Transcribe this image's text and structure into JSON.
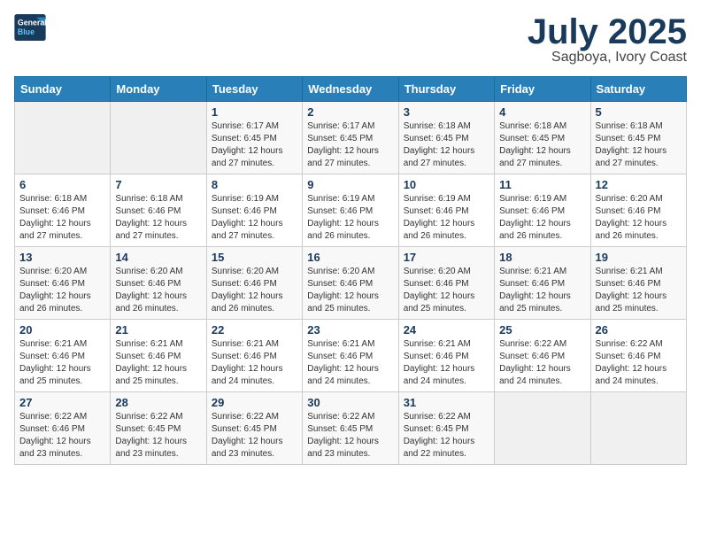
{
  "logo": {
    "line1": "General",
    "line2": "Blue"
  },
  "title": "July 2025",
  "location": "Sagboya, Ivory Coast",
  "days_of_week": [
    "Sunday",
    "Monday",
    "Tuesday",
    "Wednesday",
    "Thursday",
    "Friday",
    "Saturday"
  ],
  "weeks": [
    [
      {
        "day": "",
        "info": ""
      },
      {
        "day": "",
        "info": ""
      },
      {
        "day": "1",
        "info": "Sunrise: 6:17 AM\nSunset: 6:45 PM\nDaylight: 12 hours and 27 minutes."
      },
      {
        "day": "2",
        "info": "Sunrise: 6:17 AM\nSunset: 6:45 PM\nDaylight: 12 hours and 27 minutes."
      },
      {
        "day": "3",
        "info": "Sunrise: 6:18 AM\nSunset: 6:45 PM\nDaylight: 12 hours and 27 minutes."
      },
      {
        "day": "4",
        "info": "Sunrise: 6:18 AM\nSunset: 6:45 PM\nDaylight: 12 hours and 27 minutes."
      },
      {
        "day": "5",
        "info": "Sunrise: 6:18 AM\nSunset: 6:45 PM\nDaylight: 12 hours and 27 minutes."
      }
    ],
    [
      {
        "day": "6",
        "info": "Sunrise: 6:18 AM\nSunset: 6:46 PM\nDaylight: 12 hours and 27 minutes."
      },
      {
        "day": "7",
        "info": "Sunrise: 6:18 AM\nSunset: 6:46 PM\nDaylight: 12 hours and 27 minutes."
      },
      {
        "day": "8",
        "info": "Sunrise: 6:19 AM\nSunset: 6:46 PM\nDaylight: 12 hours and 27 minutes."
      },
      {
        "day": "9",
        "info": "Sunrise: 6:19 AM\nSunset: 6:46 PM\nDaylight: 12 hours and 26 minutes."
      },
      {
        "day": "10",
        "info": "Sunrise: 6:19 AM\nSunset: 6:46 PM\nDaylight: 12 hours and 26 minutes."
      },
      {
        "day": "11",
        "info": "Sunrise: 6:19 AM\nSunset: 6:46 PM\nDaylight: 12 hours and 26 minutes."
      },
      {
        "day": "12",
        "info": "Sunrise: 6:20 AM\nSunset: 6:46 PM\nDaylight: 12 hours and 26 minutes."
      }
    ],
    [
      {
        "day": "13",
        "info": "Sunrise: 6:20 AM\nSunset: 6:46 PM\nDaylight: 12 hours and 26 minutes."
      },
      {
        "day": "14",
        "info": "Sunrise: 6:20 AM\nSunset: 6:46 PM\nDaylight: 12 hours and 26 minutes."
      },
      {
        "day": "15",
        "info": "Sunrise: 6:20 AM\nSunset: 6:46 PM\nDaylight: 12 hours and 26 minutes."
      },
      {
        "day": "16",
        "info": "Sunrise: 6:20 AM\nSunset: 6:46 PM\nDaylight: 12 hours and 25 minutes."
      },
      {
        "day": "17",
        "info": "Sunrise: 6:20 AM\nSunset: 6:46 PM\nDaylight: 12 hours and 25 minutes."
      },
      {
        "day": "18",
        "info": "Sunrise: 6:21 AM\nSunset: 6:46 PM\nDaylight: 12 hours and 25 minutes."
      },
      {
        "day": "19",
        "info": "Sunrise: 6:21 AM\nSunset: 6:46 PM\nDaylight: 12 hours and 25 minutes."
      }
    ],
    [
      {
        "day": "20",
        "info": "Sunrise: 6:21 AM\nSunset: 6:46 PM\nDaylight: 12 hours and 25 minutes."
      },
      {
        "day": "21",
        "info": "Sunrise: 6:21 AM\nSunset: 6:46 PM\nDaylight: 12 hours and 25 minutes."
      },
      {
        "day": "22",
        "info": "Sunrise: 6:21 AM\nSunset: 6:46 PM\nDaylight: 12 hours and 24 minutes."
      },
      {
        "day": "23",
        "info": "Sunrise: 6:21 AM\nSunset: 6:46 PM\nDaylight: 12 hours and 24 minutes."
      },
      {
        "day": "24",
        "info": "Sunrise: 6:21 AM\nSunset: 6:46 PM\nDaylight: 12 hours and 24 minutes."
      },
      {
        "day": "25",
        "info": "Sunrise: 6:22 AM\nSunset: 6:46 PM\nDaylight: 12 hours and 24 minutes."
      },
      {
        "day": "26",
        "info": "Sunrise: 6:22 AM\nSunset: 6:46 PM\nDaylight: 12 hours and 24 minutes."
      }
    ],
    [
      {
        "day": "27",
        "info": "Sunrise: 6:22 AM\nSunset: 6:46 PM\nDaylight: 12 hours and 23 minutes."
      },
      {
        "day": "28",
        "info": "Sunrise: 6:22 AM\nSunset: 6:45 PM\nDaylight: 12 hours and 23 minutes."
      },
      {
        "day": "29",
        "info": "Sunrise: 6:22 AM\nSunset: 6:45 PM\nDaylight: 12 hours and 23 minutes."
      },
      {
        "day": "30",
        "info": "Sunrise: 6:22 AM\nSunset: 6:45 PM\nDaylight: 12 hours and 23 minutes."
      },
      {
        "day": "31",
        "info": "Sunrise: 6:22 AM\nSunset: 6:45 PM\nDaylight: 12 hours and 22 minutes."
      },
      {
        "day": "",
        "info": ""
      },
      {
        "day": "",
        "info": ""
      }
    ]
  ]
}
